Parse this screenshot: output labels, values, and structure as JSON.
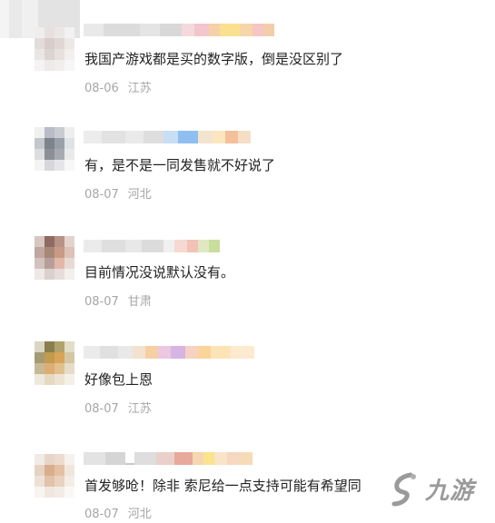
{
  "comments": [
    {
      "text": "我国产游戏都是买的数字版，倒是没区别了",
      "date": "08-06",
      "location": "江苏"
    },
    {
      "text": "有，是不是一同发售就不好说了",
      "date": "08-07",
      "location": "河北"
    },
    {
      "text": "目前情况没说默认没有。",
      "date": "08-07",
      "location": "甘肃"
    },
    {
      "text": "好像包上恩",
      "date": "08-07",
      "location": "江苏"
    },
    {
      "text": "首发够呛！除非 索尼给一点支持可能有希望同",
      "date": "08-07",
      "location": "河北"
    }
  ],
  "watermark": {
    "logo": "九游",
    "icon": "jiuyou-logo-icon"
  }
}
